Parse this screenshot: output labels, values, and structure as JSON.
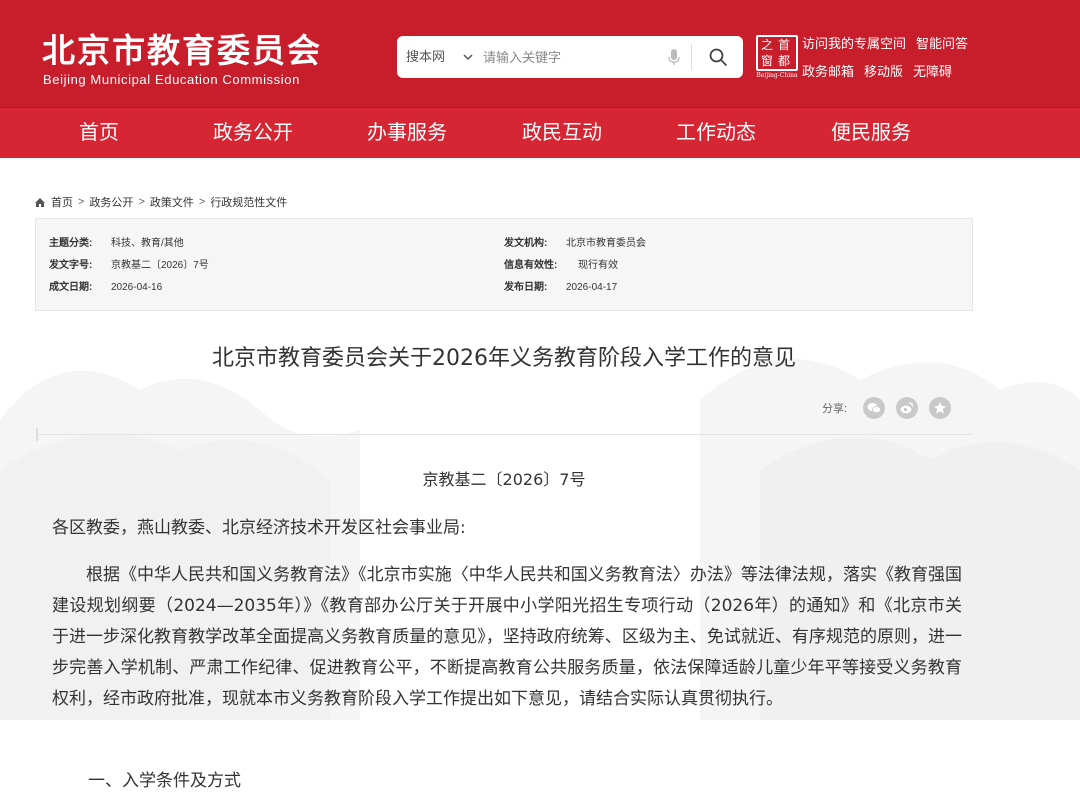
{
  "header": {
    "logo_cn": "北京市教育委员会",
    "logo_en": "Beijing Municipal Education Commission",
    "search": {
      "scope": "搜本网",
      "placeholder": "请输入关键字"
    },
    "seal": {
      "glyphs": [
        "首",
        "都",
        "之",
        "窗"
      ],
      "caption": "Beijing-China"
    },
    "links_row1": [
      "访问我的专属空间",
      "智能问答"
    ],
    "links_row2": [
      "政务邮箱",
      "移动版",
      "无障碍"
    ]
  },
  "nav": {
    "items": [
      "首页",
      "政务公开",
      "办事服务",
      "政民互动",
      "工作动态",
      "便民服务"
    ]
  },
  "breadcrumb": {
    "items": [
      "首页",
      "政务公开",
      "政策文件",
      "行政规范性文件"
    ],
    "separator": ">"
  },
  "meta": {
    "topic_label": "主题分类:",
    "topic_value": "科技、教育/其他",
    "doc_no_label": "发文字号:",
    "doc_no_value": "京教基二〔2026〕7号",
    "date_label": "成文日期:",
    "date_value": "2026-04-16",
    "issuer_label": "发文机构:",
    "issuer_value": "北京市教育委员会",
    "validity_label": "信息有效性:",
    "validity_value": "现行有效",
    "publish_label": "发布日期:",
    "publish_value": "2026-04-17"
  },
  "article": {
    "title": "北京市教育委员会关于2026年义务教育阶段入学工作的意见",
    "share_label": "分享:",
    "doc_number": "京教基二〔2026〕7号",
    "salutation": "各区教委，燕山教委、北京经济技术开发区社会事业局:",
    "paragraph1": "根据《中华人民共和国义务教育法》《北京市实施〈中华人民共和国义务教育法〉办法》等法律法规，落实《教育强国建设规划纲要（2024—2035年）》《教育部办公厅关于开展中小学阳光招生专项行动（2026年）的通知》和《北京市关于进一步深化教育教学改革全面提高义务教育质量的意见》，坚持政府统筹、区级为主、免试就近、有序规范的原则，进一步完善入学机制、严肃工作纪律、促进教育公平，不断提高教育公共服务质量，依法保障适龄儿童少年平等接受义务教育权利，经市政府批准，现就本市义务教育阶段入学工作提出如下意见，请结合实际认真贯彻执行。",
    "section1": "一、入学条件及方式"
  },
  "colors": {
    "header_red": "#c81e2c",
    "nav_red": "#d62533"
  }
}
